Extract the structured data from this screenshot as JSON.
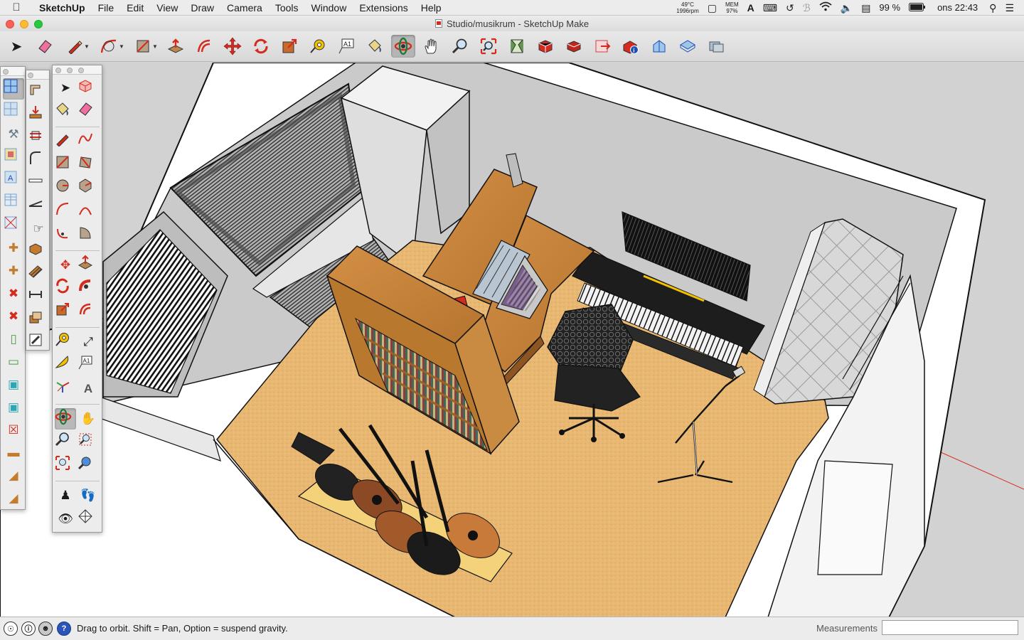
{
  "menubar": {
    "apple_glyph": "",
    "app_name": "SketchUp",
    "items": [
      "File",
      "Edit",
      "View",
      "Draw",
      "Camera",
      "Tools",
      "Window",
      "Extensions",
      "Help"
    ],
    "status": {
      "cpu_temp": "49°C",
      "fan_speed": "1996rpm",
      "mem_label": "MEM",
      "mem_value": "97%",
      "battery": "99 %",
      "clock": "ons 22:43"
    }
  },
  "window": {
    "title": "Studio/musikrum - SketchUp Make"
  },
  "toolbar": {
    "active_tool": "orbit"
  },
  "statusbar": {
    "hint": "Drag to orbit. Shift = Pan, Option = suspend gravity.",
    "measurements_label": "Measurements",
    "measurements_value": ""
  },
  "colors": {
    "carpet": "#e8b872",
    "wood": "#c6853a",
    "wall": "#c9c9c9",
    "accent_red": "#d52b1e"
  }
}
